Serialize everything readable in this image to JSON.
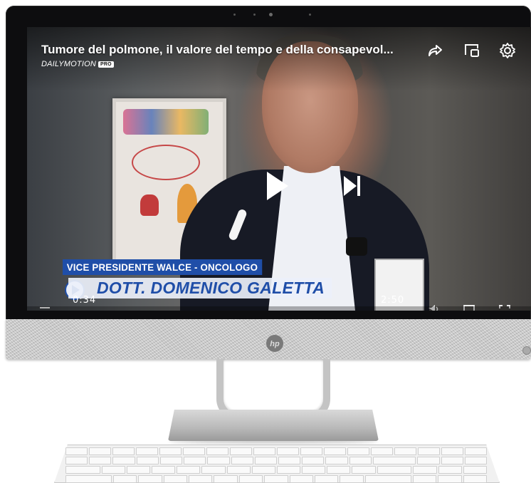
{
  "video": {
    "title": "Tumore del polmone, il valore del tempo e della consapevol...",
    "brand": "DAILYMOTION",
    "brand_badge": "PRO",
    "lower_third": {
      "role": "VICE PRESIDENTE WALCE - ONCOLOGO",
      "name": "DOTT. DOMENICO GALETTA"
    },
    "time_current": "0:34",
    "time_total": "2:50"
  },
  "icons": {
    "share": "share-icon",
    "cast": "cast-icon",
    "settings": "gear-icon",
    "play": "play-icon",
    "next": "skip-next-icon",
    "volume": "volume-icon",
    "fullscreen": "fullscreen-icon",
    "hp": "hp-logo"
  },
  "colors": {
    "lower_third_blue": "#1f4ea8",
    "bezel": "#0d0d0f",
    "chin": "#c9c9c9"
  }
}
